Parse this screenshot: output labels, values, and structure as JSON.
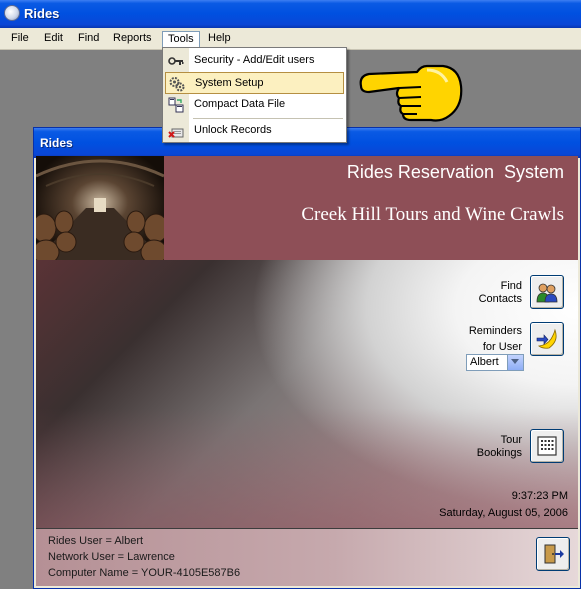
{
  "app": {
    "title": "Rides"
  },
  "menubar": {
    "items": [
      {
        "label": "File"
      },
      {
        "label": "Edit"
      },
      {
        "label": "Find"
      },
      {
        "label": "Reports"
      },
      {
        "label": "Tools"
      },
      {
        "label": "Help"
      }
    ],
    "active": "Tools"
  },
  "tools_menu": {
    "items": [
      {
        "label": "Security - Add/Edit users",
        "icon": "key-icon"
      },
      {
        "label": "System Setup",
        "icon": "gears-icon",
        "highlighted": true
      },
      {
        "label": "Compact Data File",
        "icon": "compact-file-icon"
      },
      {
        "label": "Unlock Records",
        "icon": "unlock-icon"
      }
    ]
  },
  "inner_window": {
    "title": "Rides",
    "banner": {
      "heading": "Rides Reservation  System",
      "subheading": "Creek Hill Tours and Wine Crawls"
    },
    "find_contacts": {
      "label_line1": "Find",
      "label_line2": "Contacts",
      "icon": "contacts-icon"
    },
    "reminders": {
      "label_line1": "Reminders",
      "label_line2": "for User",
      "icon": "reminder-icon",
      "selected_user": "Albert"
    },
    "tour_bookings": {
      "label_line1": "Tour",
      "label_line2": "Bookings",
      "icon": "calendar-icon"
    },
    "clock": {
      "time": "9:37:23 PM",
      "date": "Saturday, August 05, 2006"
    },
    "status": {
      "rides_user": "Rides User = Albert",
      "network_user": "Network User = Lawrence",
      "computer_name": "Computer Name = YOUR-4105E587B6"
    },
    "exit_icon": "exit-door-icon"
  },
  "colors": {
    "banner": "#8e4f57",
    "titlebar": "#0a5ae4",
    "menu_highlight": "#fcf0c0"
  }
}
